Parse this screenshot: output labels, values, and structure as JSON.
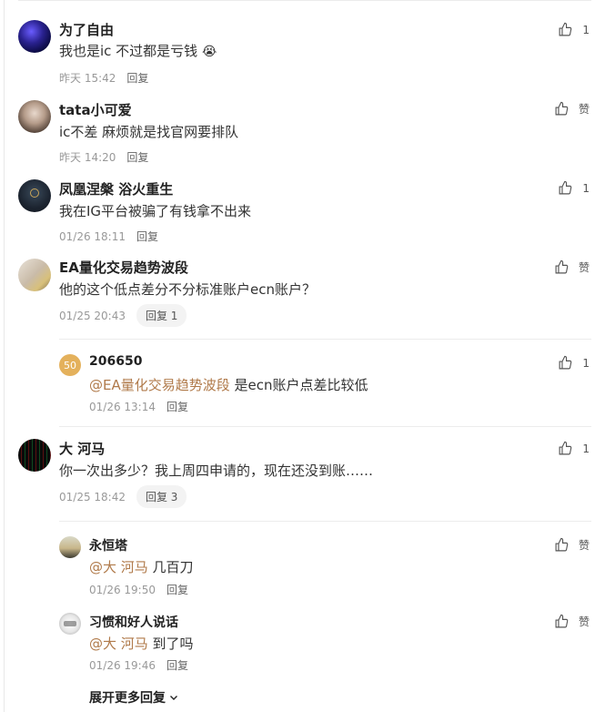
{
  "comments": [
    {
      "author": "为了自由",
      "content": "我也是ic 不过都是亏钱",
      "emoji": "😭",
      "time": "昨天 15:42",
      "reply_label": "回复",
      "likes": "1"
    },
    {
      "author": "tata小可爱",
      "content": "ic不差 麻烦就是找官网要排队",
      "time": "昨天 14:20",
      "reply_label": "回复",
      "likes": "赞"
    },
    {
      "author": "凤凰涅槃 浴火重生",
      "content": "我在IG平台被骗了有钱拿不出来",
      "time": "01/26 18:11",
      "reply_label": "回复",
      "likes": "1"
    },
    {
      "author": "EA量化交易趋势波段",
      "content": "他的这个低点差分不分标准账户ecn账户？",
      "time": "01/25 20:43",
      "reply_label": "回复 1",
      "likes": "赞"
    },
    {
      "author": "大 河马",
      "content": "你一次出多少？我上周四申请的，现在还没到账……",
      "time": "01/25 18:42",
      "reply_label": "回复 3",
      "likes": "1"
    }
  ],
  "replies": [
    {
      "badge": "50",
      "author": "206650",
      "mention": "@EA量化交易趋势波段",
      "content": " 是ecn账户点差比较低",
      "time": "01/26 13:14",
      "reply_label": "回复",
      "likes": "1"
    },
    {
      "author": "永恒塔",
      "mention": "@大 河马",
      "content": " 几百刀",
      "time": "01/26 19:50",
      "reply_label": "回复",
      "likes": "赞"
    },
    {
      "author": "习惯和好人说话",
      "mention": "@大 河马",
      "content": " 到了吗",
      "time": "01/26 19:46",
      "reply_label": "回复",
      "likes": "赞"
    }
  ],
  "more_replies_label": "展开更多回复"
}
